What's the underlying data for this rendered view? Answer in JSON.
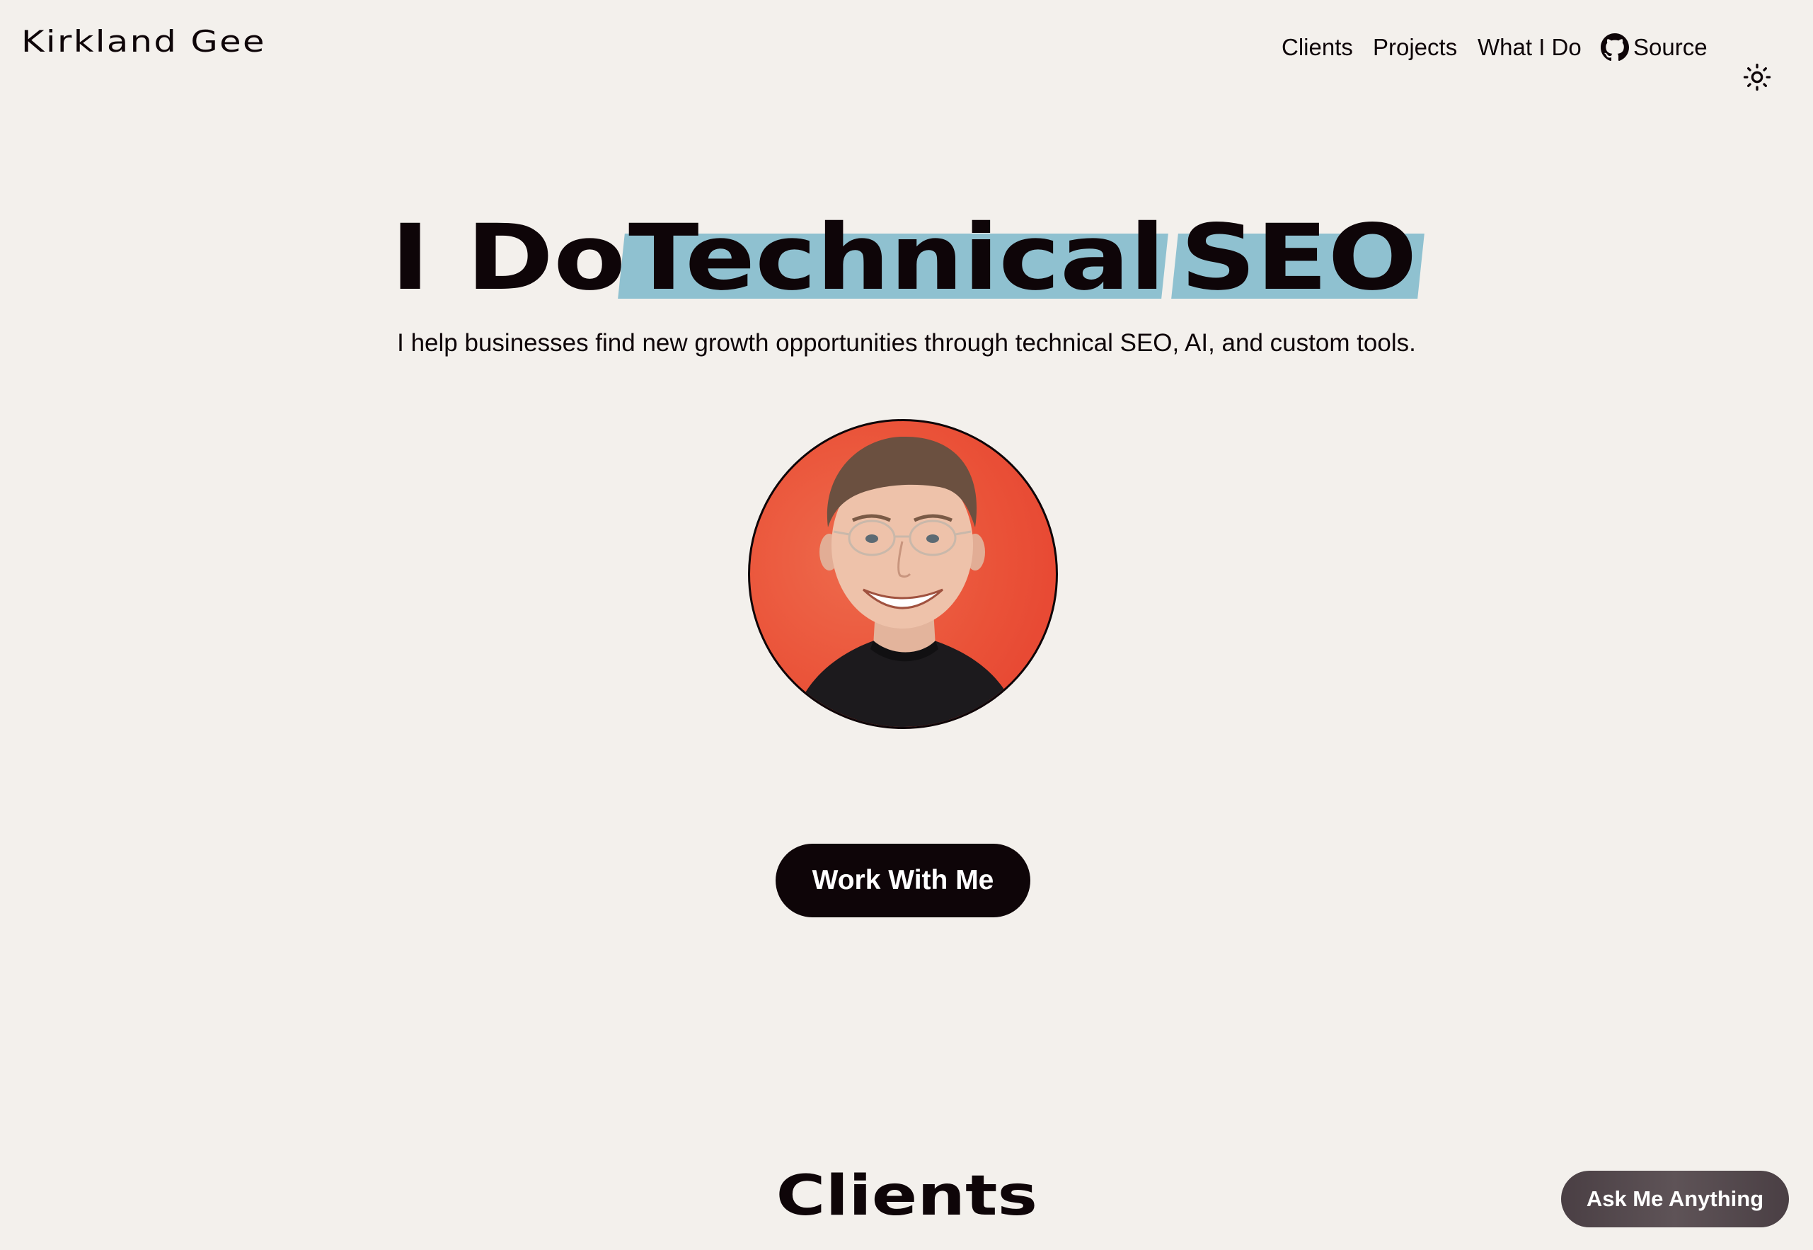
{
  "header": {
    "brand": "Kirkland Gee",
    "nav": {
      "clients": "Clients",
      "projects": "Projects",
      "what_i_do": "What I Do",
      "source": "Source"
    },
    "icons": {
      "source_icon": "github-icon",
      "theme_toggle_icon": "sun-icon"
    }
  },
  "hero": {
    "title_plain": "I Do",
    "title_highlight_1": "Technical",
    "title_highlight_2": "SEO",
    "highlight_color": "#8fc1d0",
    "subtitle": "I help businesses find new growth opportunities through technical SEO, AI, and custom tools.",
    "avatar_background": "#ea5238",
    "cta_label": "Work With Me"
  },
  "sections": {
    "clients_title": "Clients"
  },
  "chat": {
    "ask_label": "Ask Me Anything"
  },
  "colors": {
    "background": "#f3f0ec",
    "text": "#0e0508",
    "button": "#0e0508"
  }
}
